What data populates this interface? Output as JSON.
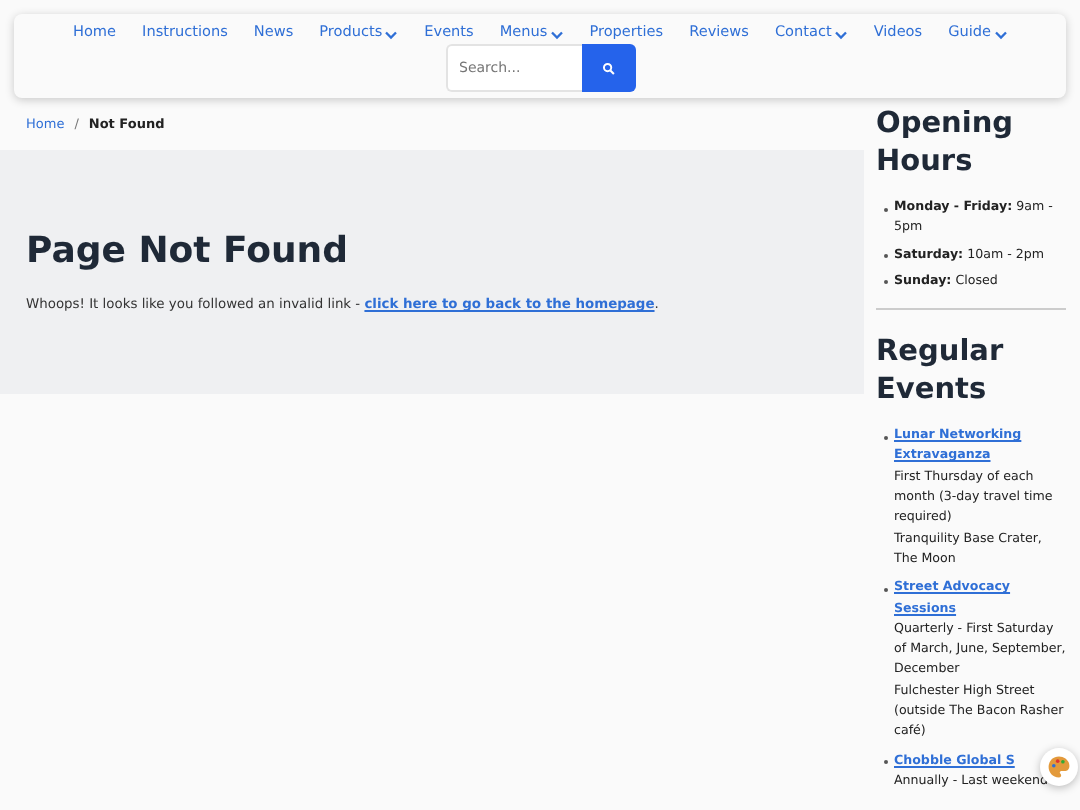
{
  "nav": [
    {
      "label": "Home",
      "dropdown": false
    },
    {
      "label": "Instructions",
      "dropdown": false
    },
    {
      "label": "News",
      "dropdown": false
    },
    {
      "label": "Products",
      "dropdown": true
    },
    {
      "label": "Events",
      "dropdown": false
    },
    {
      "label": "Menus",
      "dropdown": true
    },
    {
      "label": "Properties",
      "dropdown": false
    },
    {
      "label": "Reviews",
      "dropdown": false
    },
    {
      "label": "Contact",
      "dropdown": true
    },
    {
      "label": "Videos",
      "dropdown": false
    },
    {
      "label": "Guide",
      "dropdown": true
    }
  ],
  "search": {
    "placeholder": "Search..."
  },
  "breadcrumb": {
    "home": "Home",
    "separator": "/",
    "current": "Not Found"
  },
  "main": {
    "heading": "Page Not Found",
    "text": "Whoops! It looks like you followed an invalid link - ",
    "link": "click here to go back to the homepage",
    "after": "."
  },
  "sidebar": {
    "hours_title": "Opening Hours",
    "hours": [
      {
        "day": "Monday - Friday:",
        "time": "9am - 5pm"
      },
      {
        "day": "Saturday:",
        "time": "10am - 2pm"
      },
      {
        "day": "Sunday:",
        "time": "Closed"
      }
    ],
    "events_title": "Regular Events",
    "events": [
      {
        "title": "Lunar Networking Extravaganza",
        "lines": [
          "First Thursday of each month (3-day travel time required)",
          "Tranquility Base Crater, The Moon"
        ]
      },
      {
        "title": "Street Advocacy Sessions",
        "lines": [
          "Quarterly - First Saturday of March, June, September, December",
          "Fulchester High Street (outside The Bacon Rasher café)"
        ]
      },
      {
        "title": "Chobble Global S",
        "lines": [
          "Annually - Last weekend"
        ]
      }
    ]
  }
}
